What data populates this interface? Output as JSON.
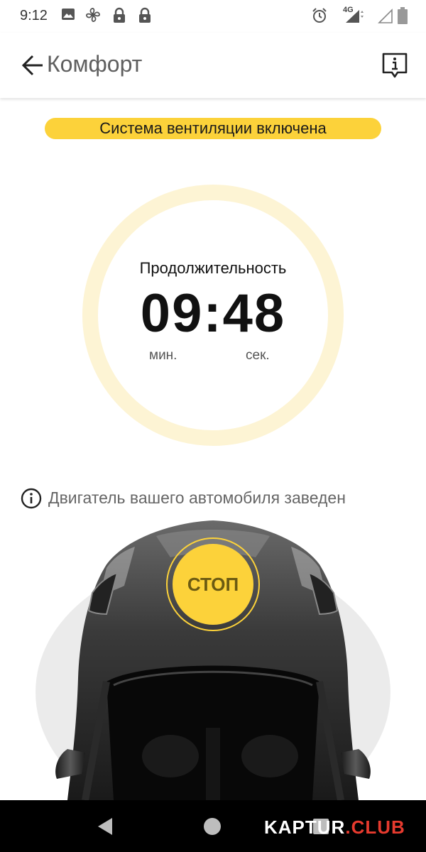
{
  "status_bar": {
    "time": "9:12",
    "network": "4G",
    "icons": [
      "image-icon",
      "fan-icon",
      "lock-icon",
      "lock-icon",
      "alarm-icon",
      "signal-icon",
      "signal-empty-icon",
      "battery-icon"
    ]
  },
  "header": {
    "back_icon": "arrow-left-icon",
    "title": "Комфорт",
    "info_icon": "info-bubble-icon"
  },
  "banner": {
    "text": "Система вентиляции включена"
  },
  "timer": {
    "label": "Продолжительность",
    "minutes": "09",
    "seconds": "48",
    "separator": ":",
    "unit_min": "мин.",
    "unit_sec": "сек."
  },
  "engine": {
    "icon": "info-circle-icon",
    "text": "Двигатель вашего автомобиля заведен"
  },
  "stop_button": {
    "label": "СТОП"
  },
  "nav": {
    "back_icon": "nav-back-icon",
    "home_icon": "nav-home-icon",
    "recents_icon": "nav-recents-icon"
  },
  "watermark": {
    "text_main": "KAPTUR",
    "text_accent": ".CLUB"
  },
  "colors": {
    "accent": "#fcd23a",
    "ring": "#fdf4d4",
    "text_dark": "#111111",
    "text_muted": "#666666",
    "nav_bg": "#000000"
  }
}
